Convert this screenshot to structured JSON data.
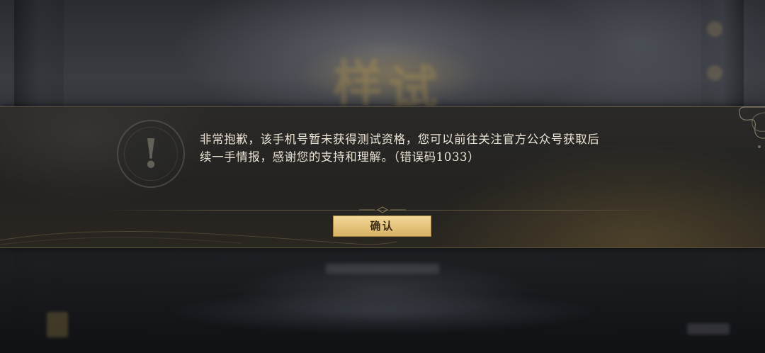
{
  "background": {
    "title_glyphs": [
      "样",
      "试"
    ]
  },
  "dialog": {
    "icon": "exclamation-icon",
    "icon_glyph": "!",
    "message": "非常抱歉，该手机号暂未获得测试资格，您可以前往关注官方公众号获取后续一手情报，感谢您的支持和理解。（错误码1033）",
    "confirm_label": "确认"
  },
  "colors": {
    "button_gold": "#e4c27a",
    "button_text": "#3a2c16",
    "message_text": "#ece5d6",
    "dialog_bg": "#252422"
  }
}
